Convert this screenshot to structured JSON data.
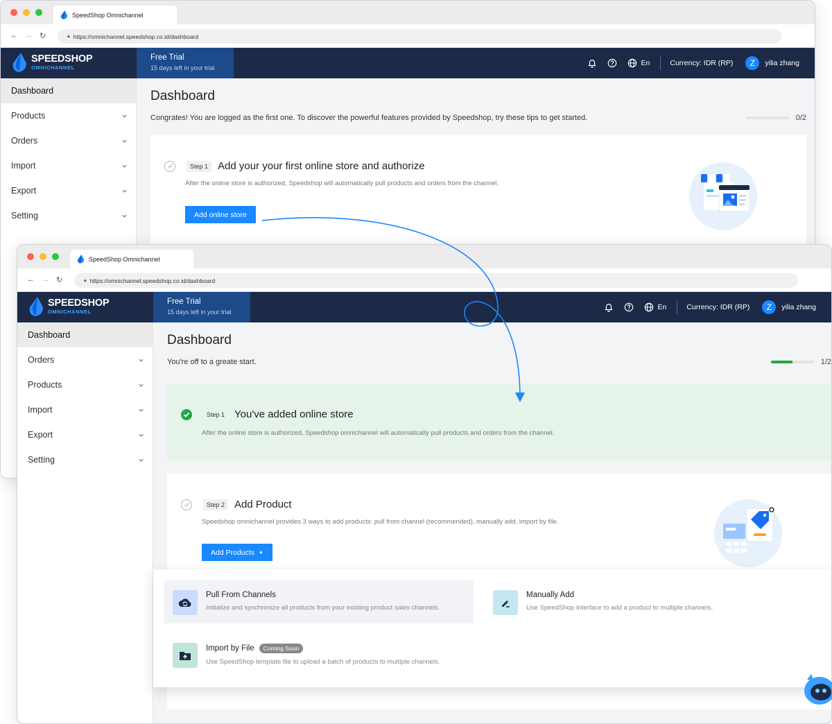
{
  "browser": {
    "tab_title": "SpeedShop Omnichannel",
    "url": "https://omnichannel.speedshop.co.id/dashboard"
  },
  "header": {
    "brand_name": "SPEEDSHOP",
    "brand_sub": "OMNICHANNEL",
    "trial_title": "Free Trial",
    "trial_sub": "15 days left in your trial",
    "lang": "En",
    "currency": "Currency: IDR (RP)",
    "avatar_initial": "Z",
    "user_name": "yilia zhang"
  },
  "window1": {
    "sidebar": [
      {
        "label": "Dashboard",
        "active": true,
        "expandable": false
      },
      {
        "label": "Products",
        "active": false,
        "expandable": true
      },
      {
        "label": "Orders",
        "active": false,
        "expandable": true
      },
      {
        "label": "Import",
        "active": false,
        "expandable": true
      },
      {
        "label": "Export",
        "active": false,
        "expandable": true
      },
      {
        "label": "Setting",
        "active": false,
        "expandable": true
      }
    ],
    "page_title": "Dashboard",
    "intro": "Congrates! You are logged as the first one. To discover the powerful features provided by Speedshop, try these tips to get started.",
    "progress_label": "0/2",
    "progress_fraction": 0,
    "step1": {
      "badge": "Step 1",
      "title": "Add your your first online store and authorize",
      "desc": "After the online store is authorized, Speedshop will automatically pull products and orders from the channel.",
      "button": "Add online store"
    }
  },
  "window2": {
    "sidebar": [
      {
        "label": "Dashboard",
        "active": true,
        "expandable": false
      },
      {
        "label": "Orders",
        "active": false,
        "expandable": true
      },
      {
        "label": "Products",
        "active": false,
        "expandable": true
      },
      {
        "label": "Import",
        "active": false,
        "expandable": true
      },
      {
        "label": "Export",
        "active": false,
        "expandable": true
      },
      {
        "label": "Setting",
        "active": false,
        "expandable": true
      }
    ],
    "page_title": "Dashboard",
    "intro": "You're off to a greate start.",
    "progress_label": "1/2",
    "progress_fraction": 0.5,
    "step1": {
      "badge": "Step 1",
      "title": "You've added online store",
      "desc": "After the online store is authorized, Speedshop omnichannel will automatically pull products and orders from the channel."
    },
    "step2": {
      "badge": "Step 2",
      "title": "Add Product",
      "desc": "Speedshop omnichannel provides 3 ways to add products: pull from channel (recommended), manually add, import by file.",
      "button": "Add Products"
    },
    "dropdown": {
      "pull": {
        "title": "Pull From Channels",
        "desc": "Initialize and synchronize all products from your existing product sales channels."
      },
      "manual": {
        "title": "Manually Add",
        "desc": "Use SpeedShop Interface to add a product to multiple channels."
      },
      "import": {
        "title": "Import by File",
        "badge": "Coming Soon",
        "desc": "Use SpeedShop template file to upload a batch of products to multiple channels."
      }
    }
  },
  "colors": {
    "header_bg": "#1c2a48",
    "trial_bg": "#1c4a8a",
    "primary": "#1a88ff",
    "success": "#26a744",
    "done_card_bg": "#e5f3e8"
  }
}
